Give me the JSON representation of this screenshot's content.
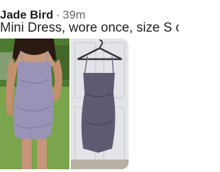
{
  "post": {
    "author": "Jade Bird",
    "separator": "·",
    "time": "39m",
    "text": "Mini Dress, wore once, size S or M,"
  },
  "photos": [
    {
      "icon": "dress-worn-photo"
    },
    {
      "icon": "dress-on-hanger-photo"
    }
  ],
  "colors": {
    "text_primary": "#1c1e21",
    "text_secondary": "#65676b",
    "dress": "#9a93b8",
    "grass": "#5e8c3a",
    "door": "#e8e8ea"
  }
}
